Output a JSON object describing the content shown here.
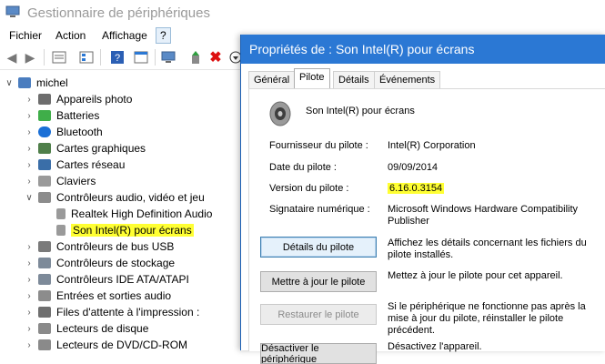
{
  "dm": {
    "title": "Gestionnaire de périphériques",
    "menu": [
      "Fichier",
      "Action",
      "Affichage",
      "?"
    ],
    "tree": {
      "root": "michel",
      "categories": [
        "Appareils photo",
        "Batteries",
        "Bluetooth",
        "Cartes graphiques",
        "Cartes réseau",
        "Claviers",
        "Contrôleurs audio, vidéo et jeu",
        "Contrôleurs de bus USB",
        "Contrôleurs de stockage",
        "Contrôleurs IDE ATA/ATAPI",
        "Entrées et sorties audio",
        "Files d'attente à l'impression :",
        "Lecteurs de disque",
        "Lecteurs de DVD/CD-ROM"
      ],
      "audio_children": [
        "Realtek High Definition Audio",
        "Son Intel(R) pour écrans"
      ]
    }
  },
  "dialog": {
    "title": "Propriétés de : Son Intel(R) pour écrans",
    "tabs": [
      "Général",
      "Pilote",
      "Détails",
      "Événements"
    ],
    "active_tab": "Pilote",
    "device_name": "Son Intel(R) pour écrans",
    "fields": {
      "provider_label": "Fournisseur du pilote :",
      "provider_value": "Intel(R) Corporation",
      "date_label": "Date du pilote :",
      "date_value": "09/09/2014",
      "version_label": "Version du pilote :",
      "version_value": "6.16.0.3154",
      "signer_label": "Signataire numérique :",
      "signer_value": "Microsoft Windows Hardware Compatibility Publisher"
    },
    "buttons": {
      "details": "Détails du pilote",
      "details_desc": "Affichez les détails concernant les fichiers du pilote installés.",
      "update": "Mettre à jour le pilote",
      "update_desc": "Mettez à jour le pilote pour cet appareil.",
      "rollback": "Restaurer le pilote",
      "rollback_desc": "Si le périphérique ne fonctionne pas après la mise à jour du pilote, réinstaller le pilote précédent.",
      "disable": "Désactiver le périphérique",
      "disable_desc": "Désactivez l'appareil."
    }
  },
  "colors": {
    "accent": "#2b78d4",
    "highlight": "#ffff33"
  }
}
